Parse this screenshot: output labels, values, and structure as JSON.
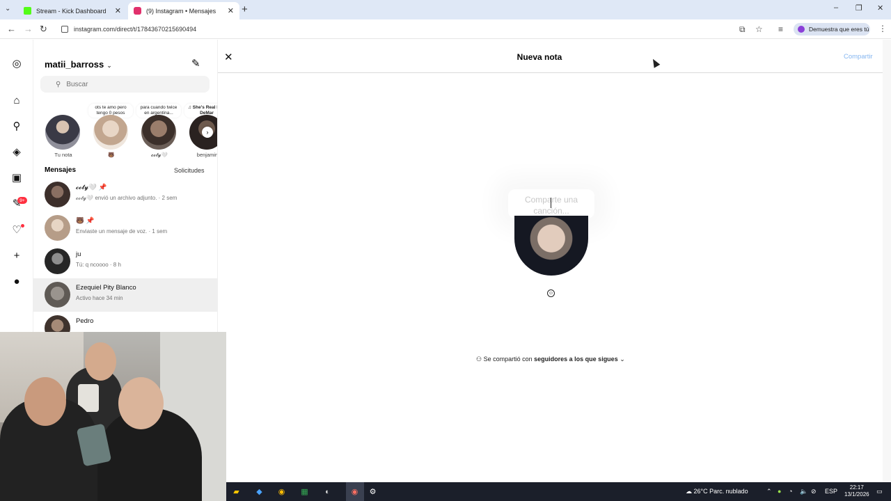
{
  "browser": {
    "tabs": [
      {
        "title": "Stream - Kick Dashboard",
        "favicon_color": "#53fc18",
        "active": false
      },
      {
        "title": "(9) Instagram • Mensajes",
        "favicon_color": "#e1306c",
        "active": true
      }
    ],
    "url": "instagram.com/direct/t/17843670215690494",
    "profile_chip": "Demuestra que eres tú"
  },
  "sidebar": {
    "icons": [
      "instagram-icon",
      "home-icon",
      "search-icon",
      "explore-icon",
      "reels-icon",
      "messenger-icon",
      "heart-icon",
      "create-icon",
      "profile-icon"
    ],
    "messages_badge": "9+"
  },
  "messages_panel": {
    "username": "matii_barross",
    "search_placeholder": "Buscar",
    "notes": [
      {
        "bubble": "",
        "label": "Tu nota"
      },
      {
        "bubble": "ots te amo pero tengo 0 pesos",
        "label": "🐻"
      },
      {
        "bubble": "para cuando twice en argentina...",
        "label": "𝓬𝓸𝓽𝔂🤍"
      },
      {
        "bubble": "♫ She's Real Mac DeMar",
        "label": "benjamin"
      }
    ],
    "header": "Mensajes",
    "requests": "Solicitudes",
    "conversations": [
      {
        "name": "𝓬𝓸𝓽𝔂🤍 📌",
        "preview": "𝓬𝓸𝓽𝔂🤍 envió un archivo adjunto. · 2 sem",
        "avatar_color": "#5b4a44",
        "highlight": false
      },
      {
        "name": "🐻 📌",
        "preview": "Enviaste un mensaje de voz. · 1 sem",
        "avatar_color": "#c9b6a3",
        "highlight": false
      },
      {
        "name": "ju",
        "preview": "Tú: q ncoooo · 8 h",
        "avatar_color": "#2e2e2e",
        "highlight": false
      },
      {
        "name": "Ezequiel Pity Blanco",
        "preview": "Activo hace 34 min",
        "avatar_color": "#7a7570",
        "highlight": true
      },
      {
        "name": "Pedro",
        "preview": "",
        "avatar_color": "#4a3d36",
        "highlight": false
      }
    ]
  },
  "new_note": {
    "title": "Nueva nota",
    "share_button": "Compartir",
    "placeholder": "Comparte una canción...",
    "audience_prefix": "Se compartió con",
    "audience_value": "seguidores a los que sigues"
  },
  "taskbar": {
    "weather": "26°C  Parc. nublado",
    "language": "ESP",
    "time": "22:17",
    "date": "13/1/2026"
  }
}
